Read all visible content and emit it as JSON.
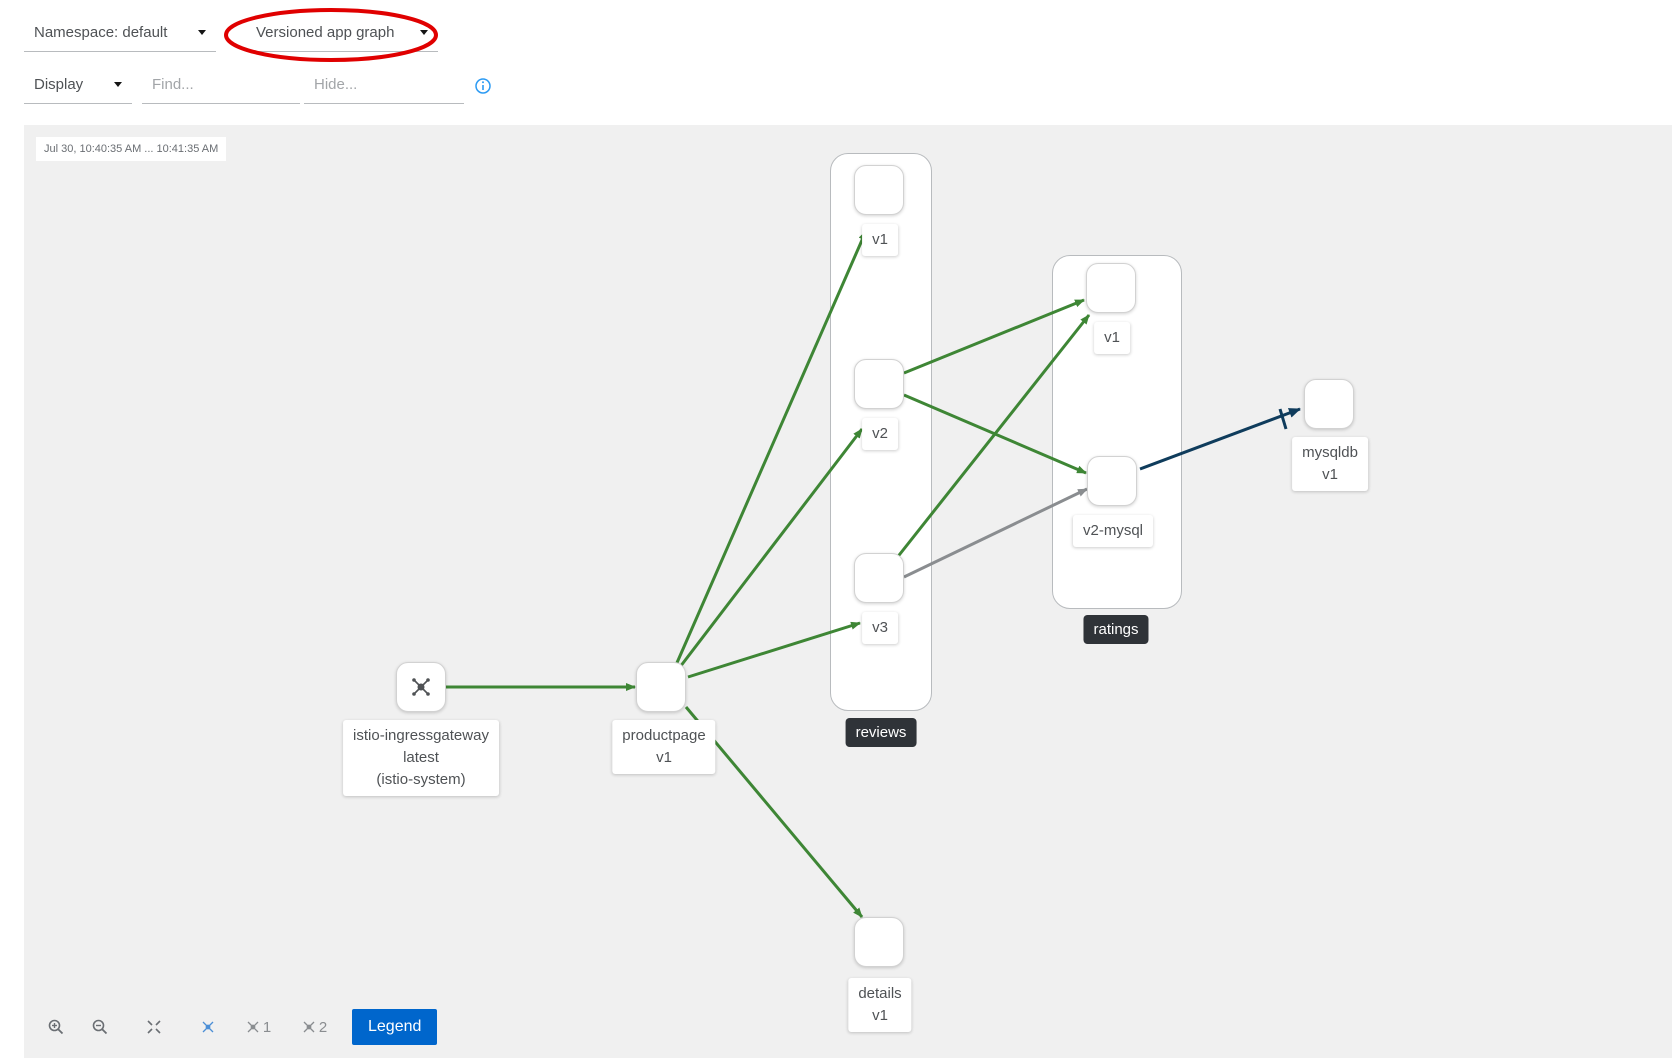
{
  "toolbar": {
    "namespace_label": "Namespace: default",
    "graph_type_label": "Versioned app graph",
    "display_label": "Display",
    "find_placeholder": "Find...",
    "hide_placeholder": "Hide..."
  },
  "graph": {
    "timestamp": "Jul 30, 10:40:35 AM ... 10:41:35 AM",
    "groups": {
      "reviews": "reviews",
      "ratings": "ratings"
    },
    "nodes": {
      "ingress": {
        "line1": "istio-ingressgateway",
        "line2": "latest",
        "line3": "(istio-system)"
      },
      "productpage": {
        "line1": "productpage",
        "line2": "v1"
      },
      "reviews_v1": "v1",
      "reviews_v2": "v2",
      "reviews_v3": "v3",
      "ratings_v1": "v1",
      "ratings_v2_mysql": "v2-mysql",
      "mysqldb": {
        "line1": "mysqldb",
        "line2": "v1"
      },
      "details": {
        "line1": "details",
        "line2": "v1"
      }
    },
    "colors": {
      "edge_ok": "#3e8635",
      "edge_idle": "#8a8d90",
      "edge_tcp": "#0f3c5c",
      "annotation": "#e00000"
    }
  },
  "controls": {
    "layout_1": "1",
    "layout_2": "2",
    "legend_label": "Legend"
  }
}
